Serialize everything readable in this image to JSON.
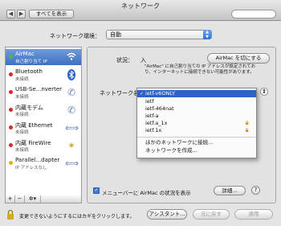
{
  "window": {
    "title": "ネットワーク"
  },
  "toolbar": {
    "back_label": "◀",
    "forward_label": "▶",
    "show_all_label": "すべてを表示"
  },
  "location": {
    "label": "ネットワーク環境：",
    "value": "自動"
  },
  "services": [
    {
      "name": "AirMac",
      "status": "自己割り当て IP",
      "dot": "green",
      "icon": "wifi-icon",
      "selected": true
    },
    {
      "name": "Bluetooth",
      "status": "未接続",
      "dot": "red",
      "icon": "bluetooth-icon"
    },
    {
      "name": "USB-Se...nverter",
      "status": "未接続",
      "dot": "red",
      "icon": "phone-icon"
    },
    {
      "name": "内蔵モデム",
      "status": "未接続",
      "dot": "red",
      "icon": "phone-icon"
    },
    {
      "name": "内蔵 Ethernet",
      "status": "未接続",
      "dot": "red",
      "icon": "ethernet-icon"
    },
    {
      "name": "内蔵 FireWire",
      "status": "未接続",
      "dot": "red",
      "icon": "firewire-icon"
    },
    {
      "name": "Parallel...dapter",
      "status": "IP アドレスなし",
      "dot": "yellow",
      "icon": "ethernet-icon"
    }
  ],
  "sidebar_tools": {
    "add": "+",
    "remove": "−",
    "gear": "✲▾"
  },
  "status": {
    "label": "状況：",
    "value": "入",
    "note": "\"AirMac\" に自己割り当ての IP アドレスが設定されており、インターネットに接続できない可能性があります。",
    "off_button": "AirMac を切にする"
  },
  "network_name": {
    "label": "ネットワーク名："
  },
  "popup": {
    "items": [
      {
        "label": "ietf-v6ONLY",
        "selected": true,
        "lock": false
      },
      {
        "label": "ietf",
        "selected": false,
        "lock": false
      },
      {
        "label": "ietf-464nat",
        "selected": false,
        "lock": false
      },
      {
        "label": "ietf-a",
        "selected": false,
        "lock": false
      },
      {
        "label": "ietf.a_1x",
        "selected": false,
        "lock": true
      },
      {
        "label": "ietf.1x",
        "selected": false,
        "lock": true
      }
    ],
    "other_join": "ほかのネットワークに接続...",
    "create": "ネットワークを作成..."
  },
  "menubar_checkbox": {
    "label": "メニューバーに AirMac の状況を表示",
    "checked": true
  },
  "details_button": "詳細...",
  "help_button": "?",
  "footer": {
    "lock_text": "変更できないようにするにはカギをクリックします。",
    "assistant": "アシスタント...",
    "revert": "元に戻す",
    "apply": "適用"
  },
  "colors": {
    "selection": "#2f62c8",
    "sidebar_selected": "#4a7ccc",
    "status_connected": "#4cbd3c",
    "status_disconnected": "#d32a2a",
    "status_warning": "#e0b21c"
  }
}
